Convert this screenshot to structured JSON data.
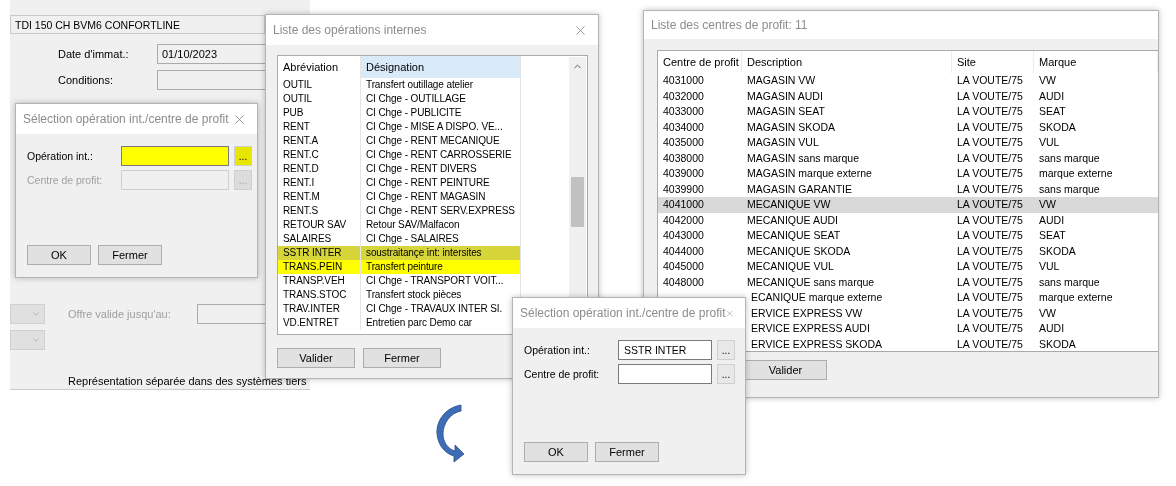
{
  "background_form": {
    "vehicle": "TDI 150 CH BVM6 CONFORTLINE",
    "fields": [
      {
        "label": "Date d'immat.:",
        "value": "01/10/2023"
      },
      {
        "label": "Conditions:"
      }
    ],
    "offer_label": "Offre valide jusqu'au:",
    "footer_text": "Représentation séparée dans des systèmes tiers"
  },
  "selection_dialog_empty": {
    "title": "Sélection opération int./centre de profit",
    "fields": [
      {
        "label": "Opération int.:",
        "browse": "...",
        "disabled": false,
        "highlighted": true
      },
      {
        "label": "Centre de profit:",
        "browse": "...",
        "disabled": true,
        "highlighted": false
      }
    ],
    "buttons": [
      "OK",
      "Fermer"
    ]
  },
  "operations_list": {
    "title": "Liste des opérations internes",
    "columns": [
      {
        "label": "Abréviation",
        "sorted": false
      },
      {
        "label": "Désignation",
        "sorted": true
      }
    ],
    "rows": [
      {
        "abbreviation": "OUTIL",
        "designation": "Transfert outillage atelier",
        "selected": false,
        "highlighted": false
      },
      {
        "abbreviation": "OUTIL",
        "designation": "CI Chge - OUTILLAGE",
        "selected": false,
        "highlighted": false
      },
      {
        "abbreviation": "PUB",
        "designation": "CI Chge - PUBLICITE",
        "selected": false,
        "highlighted": false
      },
      {
        "abbreviation": "RENT",
        "designation": "CI Chge - MISE A DISPO. VE...",
        "selected": false,
        "highlighted": false
      },
      {
        "abbreviation": "RENT.A",
        "designation": "CI Chge - RENT MECANIQUE",
        "selected": false,
        "highlighted": false
      },
      {
        "abbreviation": "RENT.C",
        "designation": "CI Chge - RENT CARROSSERIE",
        "selected": false,
        "highlighted": false
      },
      {
        "abbreviation": "RENT.D",
        "designation": "CI Chge - RENT DIVERS",
        "selected": false,
        "highlighted": false
      },
      {
        "abbreviation": "RENT.I",
        "designation": "CI Chge - RENT PEINTURE",
        "selected": false,
        "highlighted": false
      },
      {
        "abbreviation": "RENT.M",
        "designation": "CI Chge - RENT MAGASIN",
        "selected": false,
        "highlighted": false
      },
      {
        "abbreviation": "RENT.S",
        "designation": "CI Chge - RENT SERV.EXPRESS",
        "selected": false,
        "highlighted": false
      },
      {
        "abbreviation": "RETOUR SAV",
        "designation": "Retour SAV/Malfacon",
        "selected": false,
        "highlighted": false
      },
      {
        "abbreviation": "SALAIRES",
        "designation": "CI Chge - SALAIRES",
        "selected": false,
        "highlighted": false
      },
      {
        "abbreviation": "SSTR INTER",
        "designation": "soustraitançe int: intersites",
        "selected": true,
        "highlighted": true
      },
      {
        "abbreviation": "TRANS.PEIN",
        "designation": "Transfert peinture",
        "selected": false,
        "highlighted": true
      },
      {
        "abbreviation": "TRANSP.VEH",
        "designation": "CI Chge - TRANSPORT VOIT...",
        "selected": false,
        "highlighted": false
      },
      {
        "abbreviation": "TRANS.STOC",
        "designation": "Transfert stock pièces",
        "selected": false,
        "highlighted": false
      },
      {
        "abbreviation": "TRAV.INTER",
        "designation": "CI Chge - TRAVAUX INTER SI.",
        "selected": false,
        "highlighted": false
      },
      {
        "abbreviation": "VD.ENTRET",
        "designation": "Entretien parc Demo car",
        "selected": false,
        "highlighted": false
      }
    ],
    "buttons": [
      "Valider",
      "Fermer"
    ]
  },
  "profit_centres_list": {
    "title": "Liste des centres de profit: 11",
    "columns": [
      "Centre de profit",
      "Description",
      "Site",
      "Marque"
    ],
    "rows": [
      {
        "centre": "4031000",
        "description": "MAGASIN VW",
        "site": "LA VOUTE/75",
        "brand": "VW",
        "selected": false
      },
      {
        "centre": "4032000",
        "description": "MAGASIN AUDI",
        "site": "LA VOUTE/75",
        "brand": "AUDI",
        "selected": false
      },
      {
        "centre": "4033000",
        "description": "MAGASIN SEAT",
        "site": "LA VOUTE/75",
        "brand": "SEAT",
        "selected": false
      },
      {
        "centre": "4034000",
        "description": "MAGASIN SKODA",
        "site": "LA VOUTE/75",
        "brand": "SKODA",
        "selected": false
      },
      {
        "centre": "4035000",
        "description": "MAGASIN VUL",
        "site": "LA VOUTE/75",
        "brand": "VUL",
        "selected": false
      },
      {
        "centre": "4038000",
        "description": "MAGASIN sans marque",
        "site": "LA VOUTE/75",
        "brand": "sans marque",
        "selected": false
      },
      {
        "centre": "4039000",
        "description": "MAGASIN marque externe",
        "site": "LA VOUTE/75",
        "brand": "marque externe",
        "selected": false
      },
      {
        "centre": "4039900",
        "description": "MAGASIN GARANTIE",
        "site": "LA VOUTE/75",
        "brand": "sans marque",
        "selected": false
      },
      {
        "centre": "4041000",
        "description": "MECANIQUE VW",
        "site": "LA VOUTE/75",
        "brand": "VW",
        "selected": true
      },
      {
        "centre": "4042000",
        "description": "MECANIQUE AUDI",
        "site": "LA VOUTE/75",
        "brand": "AUDI",
        "selected": false
      },
      {
        "centre": "4043000",
        "description": "MECANIQUE SEAT",
        "site": "LA VOUTE/75",
        "brand": "SEAT",
        "selected": false
      },
      {
        "centre": "4044000",
        "description": "MECANIQUE SKODA",
        "site": "LA VOUTE/75",
        "brand": "SKODA",
        "selected": false
      },
      {
        "centre": "4045000",
        "description": "MECANIQUE VUL",
        "site": "LA VOUTE/75",
        "brand": "VUL",
        "selected": false
      },
      {
        "centre": "4048000",
        "description": "MECANIQUE sans marque",
        "site": "LA VOUTE/75",
        "brand": "sans marque",
        "selected": false
      },
      {
        "description": "ECANIQUE marque externe",
        "site": "LA VOUTE/75",
        "brand": "marque externe",
        "selected": false
      },
      {
        "description": "ERVICE EXPRESS VW",
        "site": "LA VOUTE/75",
        "brand": "VW",
        "selected": false
      },
      {
        "description": "ERVICE EXPRESS AUDI",
        "site": "LA VOUTE/75",
        "brand": "AUDI",
        "selected": false
      },
      {
        "description": "ERVICE EXPRESS SKODA",
        "site": "LA VOUTE/75",
        "brand": "SKODA",
        "selected": false
      }
    ],
    "buttons": [
      "Valider"
    ]
  },
  "selection_dialog_filled": {
    "title": "Sélection opération int./centre de profit",
    "fields": [
      {
        "label": "Opération int.:",
        "value": "SSTR INTER",
        "browse": "...",
        "disabled": false,
        "highlighted": false
      },
      {
        "label": "Centre de profit:",
        "browse": "...",
        "disabled": false,
        "highlighted": false
      }
    ],
    "buttons": [
      "OK",
      "Fermer"
    ]
  }
}
